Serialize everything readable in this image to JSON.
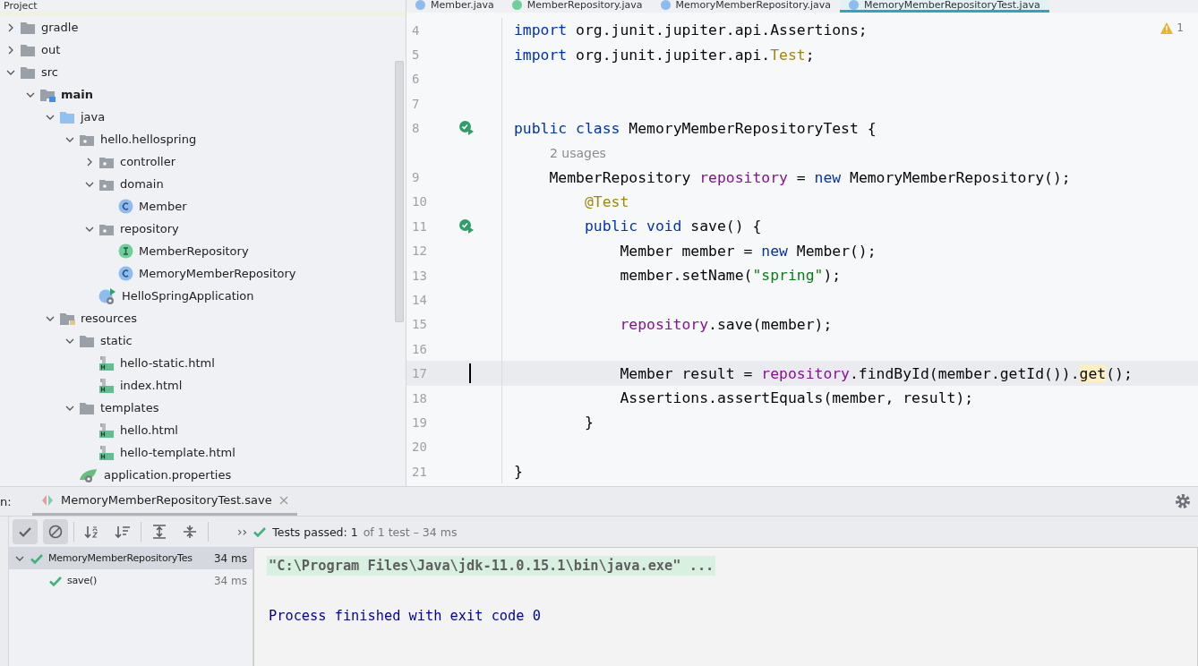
{
  "project_panel": {
    "title": "Project",
    "tree": [
      {
        "label": "gradle",
        "kind": "folder",
        "expanded": false
      },
      {
        "label": "out",
        "kind": "folder",
        "expanded": false
      },
      {
        "label": "src",
        "kind": "folder",
        "expanded": true,
        "children": [
          {
            "label": "main",
            "kind": "source-root",
            "expanded": true,
            "children": [
              {
                "label": "java",
                "kind": "java-root",
                "expanded": true,
                "children": [
                  {
                    "label": "hello.hellospring",
                    "kind": "package",
                    "expanded": true,
                    "children": [
                      {
                        "label": "controller",
                        "kind": "package",
                        "expanded": false
                      },
                      {
                        "label": "domain",
                        "kind": "package",
                        "expanded": true,
                        "children": [
                          {
                            "label": "Member",
                            "kind": "class"
                          }
                        ]
                      },
                      {
                        "label": "repository",
                        "kind": "package",
                        "expanded": true,
                        "children": [
                          {
                            "label": "MemberRepository",
                            "kind": "interface"
                          },
                          {
                            "label": "MemoryMemberRepository",
                            "kind": "class"
                          }
                        ]
                      },
                      {
                        "label": "HelloSpringApplication",
                        "kind": "app"
                      }
                    ]
                  }
                ]
              },
              {
                "label": "resources",
                "kind": "resources-root",
                "expanded": true,
                "children": [
                  {
                    "label": "static",
                    "kind": "folder",
                    "expanded": true,
                    "children": [
                      {
                        "label": "hello-static.html",
                        "kind": "html"
                      },
                      {
                        "label": "index.html",
                        "kind": "html"
                      }
                    ]
                  },
                  {
                    "label": "templates",
                    "kind": "folder",
                    "expanded": true,
                    "children": [
                      {
                        "label": "hello.html",
                        "kind": "html"
                      },
                      {
                        "label": "hello-template.html",
                        "kind": "html"
                      }
                    ]
                  },
                  {
                    "label": "application.properties",
                    "kind": "properties"
                  }
                ]
              }
            ]
          }
        ]
      }
    ]
  },
  "editor": {
    "tabs": [
      {
        "label": "Member.java",
        "kind": "class",
        "selected": false
      },
      {
        "label": "MemberRepository.java",
        "kind": "interface",
        "selected": false
      },
      {
        "label": "MemoryMemberRepository.java",
        "kind": "class",
        "selected": false
      },
      {
        "label": "MemoryMemberRepositoryTest.java",
        "kind": "class",
        "selected": true
      }
    ],
    "warnings": "1",
    "lines": [
      {
        "kind": "code",
        "number": "4",
        "run": false,
        "current": false,
        "tokens": [
          {
            "text": "import",
            "kind": "keyword"
          },
          {
            "text": " org.junit.jupiter.api.Assertions;",
            "kind": "plain"
          }
        ]
      },
      {
        "kind": "code",
        "number": "5",
        "run": false,
        "current": false,
        "tokens": [
          {
            "text": "import",
            "kind": "keyword"
          },
          {
            "text": " org.junit.jupiter.api.",
            "kind": "plain"
          },
          {
            "text": "Test",
            "kind": "annotation"
          },
          {
            "text": ";",
            "kind": "plain"
          }
        ]
      },
      {
        "kind": "code",
        "number": "6",
        "run": false,
        "current": false
      },
      {
        "kind": "code",
        "number": "7",
        "run": false,
        "current": false
      },
      {
        "kind": "code",
        "number": "8",
        "run": true,
        "current": false,
        "tokens": [
          {
            "text": "public class",
            "kind": "keyword"
          },
          {
            "text": " MemoryMemberRepositoryTest {",
            "kind": "plain"
          }
        ]
      },
      {
        "kind": "hint",
        "text": "2 usages"
      },
      {
        "kind": "code",
        "number": "9",
        "run": false,
        "current": false,
        "tokens": [
          {
            "text": "    MemberRepository ",
            "kind": "plain"
          },
          {
            "text": "repository",
            "kind": "field"
          },
          {
            "text": " = ",
            "kind": "plain"
          },
          {
            "text": "new",
            "kind": "keyword"
          },
          {
            "text": " MemoryMemberRepository();",
            "kind": "plain"
          }
        ]
      },
      {
        "kind": "code",
        "number": "10",
        "run": false,
        "current": false,
        "tokens": [
          {
            "text": "        @Test",
            "kind": "annotation"
          }
        ]
      },
      {
        "kind": "code",
        "number": "11",
        "run": true,
        "current": false,
        "tokens": [
          {
            "text": "        public void",
            "kind": "keyword"
          },
          {
            "text": " save() {",
            "kind": "plain"
          }
        ]
      },
      {
        "kind": "code",
        "number": "12",
        "run": false,
        "current": false,
        "tokens": [
          {
            "text": "            Member member = ",
            "kind": "plain"
          },
          {
            "text": "new",
            "kind": "keyword"
          },
          {
            "text": " Member();",
            "kind": "plain"
          }
        ]
      },
      {
        "kind": "code",
        "number": "13",
        "run": false,
        "current": false,
        "tokens": [
          {
            "text": "            member.setName(",
            "kind": "plain"
          },
          {
            "text": "\"spring\"",
            "kind": "string"
          },
          {
            "text": ");",
            "kind": "plain"
          }
        ]
      },
      {
        "kind": "code",
        "number": "14",
        "run": false,
        "current": false
      },
      {
        "kind": "code",
        "number": "15",
        "run": false,
        "current": false,
        "tokens": [
          {
            "text": "            repository",
            "kind": "field"
          },
          {
            "text": ".save(member);",
            "kind": "plain"
          }
        ]
      },
      {
        "kind": "code",
        "number": "16",
        "run": false,
        "current": false
      },
      {
        "kind": "code",
        "number": "17",
        "run": false,
        "current": true,
        "tokens": [
          {
            "text": "            Member result = ",
            "kind": "plain"
          },
          {
            "text": "repository",
            "kind": "field"
          },
          {
            "text": ".findById(member.getId()).",
            "kind": "plain"
          },
          {
            "text": "get",
            "kind": "match"
          },
          {
            "text": "();",
            "kind": "plain"
          }
        ]
      },
      {
        "kind": "code",
        "number": "18",
        "run": false,
        "current": false,
        "tokens": [
          {
            "text": "            Assertions.assertEquals(member, result);",
            "kind": "plain"
          }
        ]
      },
      {
        "kind": "code",
        "number": "19",
        "run": false,
        "current": false,
        "tokens": [
          {
            "text": "        }",
            "kind": "plain"
          }
        ]
      },
      {
        "kind": "code",
        "number": "20",
        "run": false,
        "current": false
      },
      {
        "kind": "code",
        "number": "21",
        "run": false,
        "current": false,
        "tokens": [
          {
            "text": "}",
            "kind": "plain"
          }
        ]
      }
    ]
  },
  "run_panel": {
    "label": "n:",
    "tab": "MemoryMemberRepositoryTest.save",
    "toolbar": [
      {
        "kind": "passed",
        "selected": true
      },
      {
        "kind": "ignored",
        "selected": true
      },
      {
        "kind": "sort-alpha",
        "selected": false
      },
      {
        "kind": "sort-duration",
        "selected": false
      },
      {
        "kind": "expand",
        "selected": false
      },
      {
        "kind": "collapse",
        "selected": false
      }
    ],
    "more": "››",
    "status": {
      "label": "Tests passed:",
      "passed": "1",
      "rest": "of 1 test – 34 ms"
    },
    "tests": [
      {
        "name": "MemoryMemberRepositoryTes",
        "time": "34 ms",
        "expanded": true,
        "selected": true,
        "children": [
          {
            "name": "save()",
            "time": "34 ms",
            "selected": false
          }
        ]
      }
    ],
    "console": [
      {
        "kind": "command",
        "text": "\"C:\\Program Files\\Java\\jdk-11.0.15.1\\bin\\java.exe\" ..."
      },
      {
        "kind": "output",
        "text": "Process finished with exit code 0"
      }
    ]
  }
}
